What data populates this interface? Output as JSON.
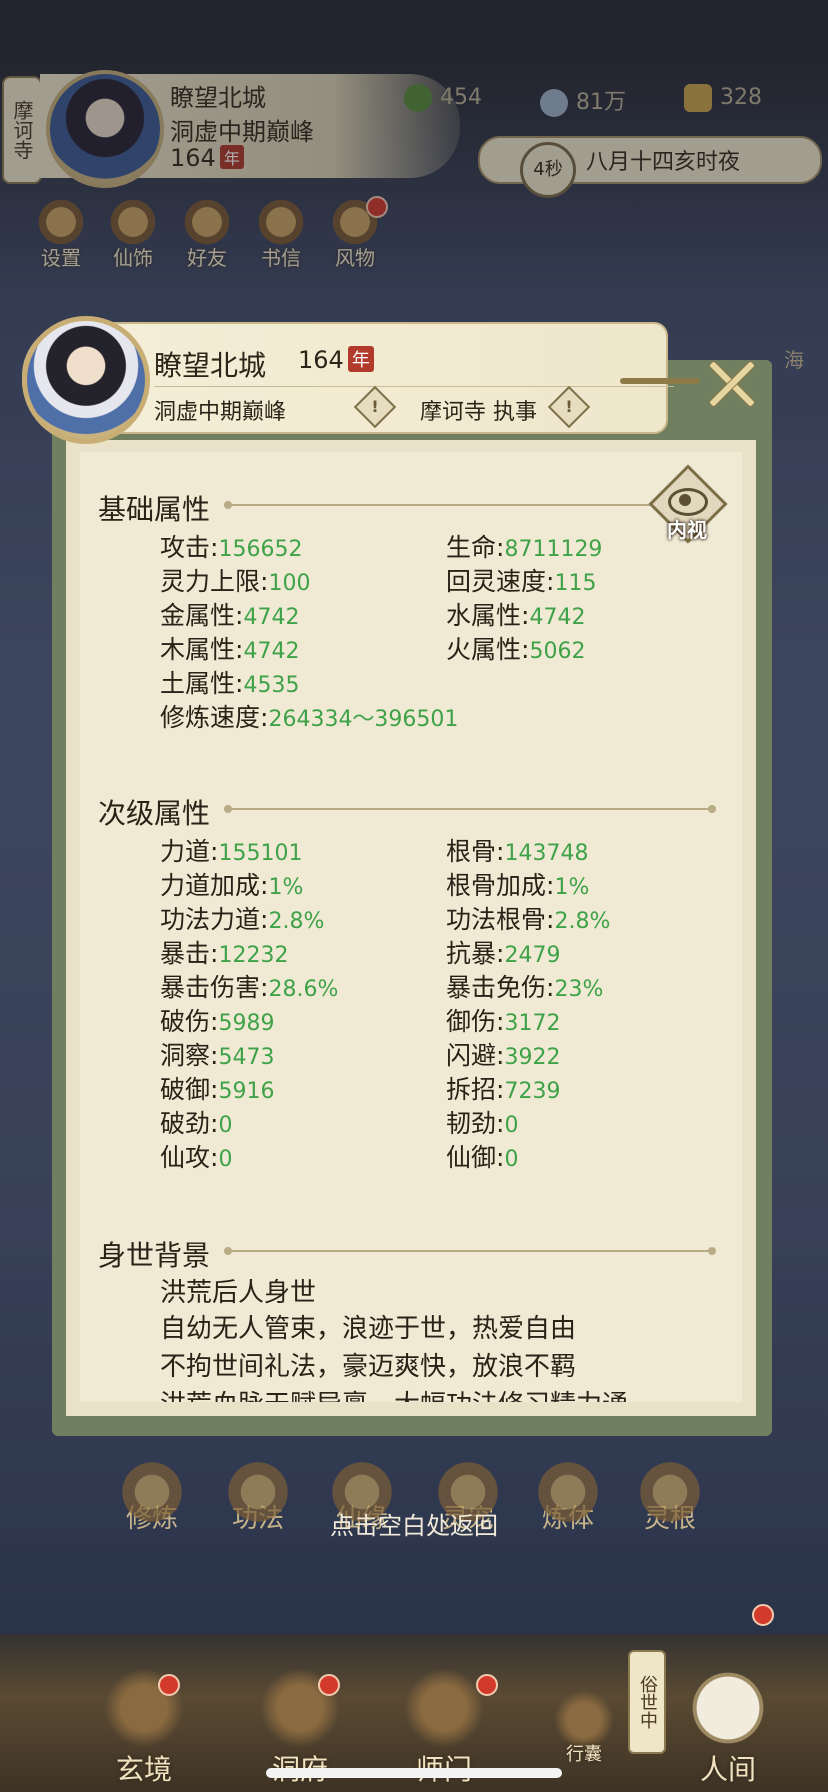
{
  "header": {
    "sect_tag": "摩诃寺",
    "player_name": "瞭望北城",
    "realm": "洞虚中期巅峰",
    "age": "164",
    "year_badge": "年",
    "resources": [
      {
        "icon": "jade-leaf-icon",
        "value": "454"
      },
      {
        "icon": "spirit-coin-icon",
        "value": "81万"
      },
      {
        "icon": "gold-ingot-icon",
        "value": "328"
      }
    ],
    "timer": "4秒",
    "date_text": "八月十四亥时夜",
    "shortcuts": [
      {
        "label": "设置",
        "icon": "settings-icon"
      },
      {
        "label": "仙饰",
        "icon": "outfit-icon"
      },
      {
        "label": "好友",
        "icon": "friends-icon"
      },
      {
        "label": "书信",
        "icon": "letter-icon"
      },
      {
        "label": "风物",
        "icon": "scenery-icon"
      }
    ],
    "right_edge_label": "海"
  },
  "dialog": {
    "name": "瞭望北城",
    "age": "164",
    "year_badge": "年",
    "realm": "洞虚中期巅峰",
    "sect_role": "摩诃寺 执事",
    "info_mark": "!",
    "inner_view_label": "内视",
    "basic": {
      "title": "基础属性",
      "stats": [
        {
          "label": "攻击",
          "value": "156652"
        },
        {
          "label": "生命",
          "value": "8711129"
        },
        {
          "label": "灵力上限",
          "value": "100"
        },
        {
          "label": "回灵速度",
          "value": "115"
        },
        {
          "label": "金属性",
          "value": "4742"
        },
        {
          "label": "水属性",
          "value": "4742"
        },
        {
          "label": "木属性",
          "value": "4742"
        },
        {
          "label": "火属性",
          "value": "5062"
        },
        {
          "label": "土属性",
          "value": "4535"
        },
        {
          "label": "修炼速度",
          "value": "264334～396501"
        }
      ]
    },
    "secondary": {
      "title": "次级属性",
      "stats": [
        {
          "label": "力道",
          "value": "155101"
        },
        {
          "label": "根骨",
          "value": "143748"
        },
        {
          "label": "力道加成",
          "value": "1%"
        },
        {
          "label": "根骨加成",
          "value": "1%"
        },
        {
          "label": "功法力道",
          "value": "2.8%"
        },
        {
          "label": "功法根骨",
          "value": "2.8%"
        },
        {
          "label": "暴击",
          "value": "12232"
        },
        {
          "label": "抗暴",
          "value": "2479"
        },
        {
          "label": "暴击伤害",
          "value": "28.6%"
        },
        {
          "label": "暴击免伤",
          "value": "23%"
        },
        {
          "label": "破伤",
          "value": "5989"
        },
        {
          "label": "御伤",
          "value": "3172"
        },
        {
          "label": "洞察",
          "value": "5473"
        },
        {
          "label": "闪避",
          "value": "3922"
        },
        {
          "label": "破御",
          "value": "5916"
        },
        {
          "label": "拆招",
          "value": "7239"
        },
        {
          "label": "破劲",
          "value": "0"
        },
        {
          "label": "韧劲",
          "value": "0"
        },
        {
          "label": "仙攻",
          "value": "0"
        },
        {
          "label": "仙御",
          "value": "0"
        }
      ]
    },
    "background": {
      "title": "身世背景",
      "lines": [
        "洪荒后人身世",
        "自幼无人管束，浪迹于世，热爱自由",
        "不拘世间礼法，豪迈爽快，放浪不羁",
        "洪荒血脉天赋异禀，大幅功法修习精力通"
      ]
    }
  },
  "skills": [
    {
      "label": "修炼",
      "icon": "cultivate-icon"
    },
    {
      "label": "功法",
      "icon": "technique-icon"
    },
    {
      "label": "仙缘",
      "icon": "fate-icon"
    },
    {
      "label": "灵宠",
      "icon": "pet-icon"
    },
    {
      "label": "炼体",
      "icon": "body-icon"
    },
    {
      "label": "灵根",
      "icon": "root-icon"
    }
  ],
  "hint": "点击空白处返回",
  "bottom_nav": [
    {
      "label": "玄境",
      "icon": "realm-icon"
    },
    {
      "label": "洞府",
      "icon": "cave-icon"
    },
    {
      "label": "师门",
      "icon": "sect-icon"
    },
    {
      "label": "行囊",
      "icon": "bag-icon"
    },
    {
      "label": "人间",
      "icon": "mortal-world-icon"
    }
  ],
  "world_tag": "俗世中"
}
